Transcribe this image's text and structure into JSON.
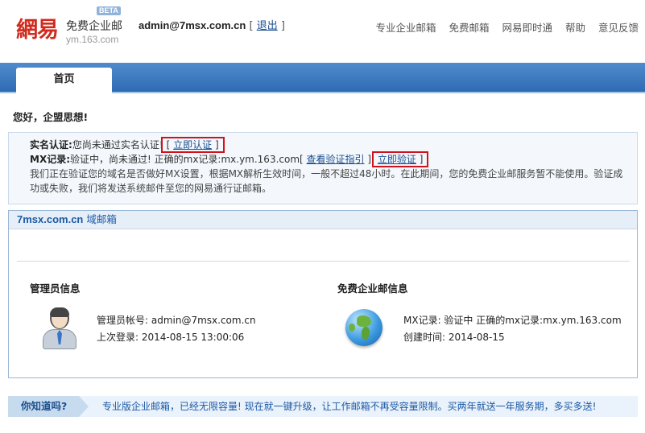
{
  "header": {
    "logo_mark": "網易",
    "logo_name": "免费企业邮",
    "logo_url": "ym.163.com",
    "beta": "BETA",
    "user_email": "admin@7msx.com.cn",
    "logout": "退出",
    "nav": [
      "专业企业邮箱",
      "免费邮箱",
      "网易即时通",
      "帮助",
      "意见反馈"
    ]
  },
  "tabs": {
    "home": "首页"
  },
  "greeting": "您好，企盟思想!",
  "notice": {
    "realname_label": "实名认证:",
    "realname_status": "您尚未通过实名认证!",
    "realname_action": "立即认证",
    "mx_label": "MX记录:",
    "mx_status": "验证中，尚未通过! 正确的mx记录:mx.ym.163.com",
    "mx_guide": "查看验证指引",
    "mx_action": "立即验证",
    "description": "我们正在验证您的域名是否做好MX设置，根据MX解析生效时间，一般不超过48小时。在此期间，您的免费企业邮服务暂不能使用。验证成功或失败，我们将发送系统邮件至您的网易通行证邮箱。"
  },
  "panel": {
    "domain": "7msx.com.cn",
    "suffix": "域邮箱",
    "admin": {
      "title": "管理员信息",
      "account": "管理员帐号: admin@7msx.com.cn",
      "last_login": "上次登录: 2014-08-15 13:00:06"
    },
    "free": {
      "title": "免费企业邮信息",
      "mx": "MX记录: 验证中 正确的mx记录:mx.ym.163.com",
      "created": "创建时间: 2014-08-15"
    }
  },
  "tip": {
    "label": "你知道吗?",
    "text": "专业版企业邮箱，已经无限容量! 现在就一键升级，让工作邮箱不再受容量限制。买两年就送一年服务期，多买多送!"
  },
  "colors": {
    "brand_red": "#d12b1e",
    "tab_blue": "#3d7ac0",
    "highlight_red": "#d0121a",
    "link_blue": "#1a4f8f"
  }
}
